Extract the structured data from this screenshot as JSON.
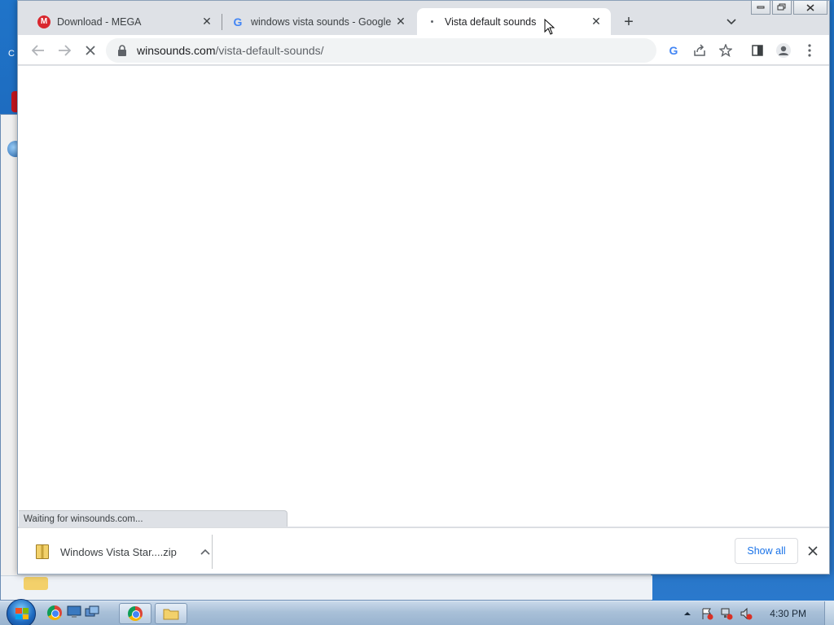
{
  "desktop": {
    "fragment_text": "C"
  },
  "browser": {
    "tabs": [
      {
        "title": "Download - MEGA",
        "favicon": "mega-icon",
        "active": false
      },
      {
        "title": "windows vista sounds - Google S",
        "favicon": "google-icon",
        "active": false
      },
      {
        "title": "Vista default sounds",
        "favicon": "loading-icon",
        "active": true
      }
    ],
    "new_tab_label": "+",
    "address": {
      "host": "winsounds.com",
      "path": "/vista-default-sounds/"
    },
    "status_text": "Waiting for winsounds.com..."
  },
  "downloads": {
    "items": [
      {
        "name": "Windows Vista Star....zip"
      }
    ],
    "show_all_label": "Show all"
  },
  "taskbar": {
    "clock": "4:30 PM"
  },
  "colors": {
    "link_blue": "#1a73e8",
    "tabstrip": "#dee1e6",
    "mega_red": "#d9272e"
  }
}
